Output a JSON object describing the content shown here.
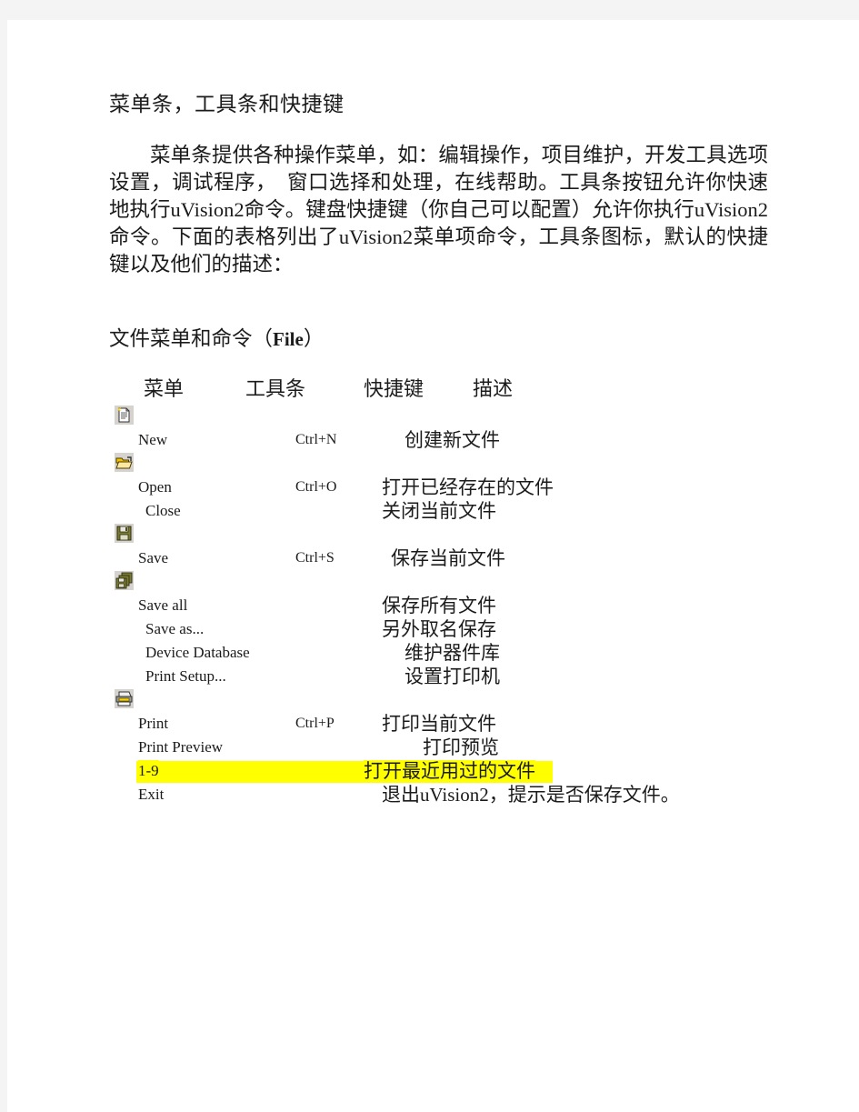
{
  "document": {
    "title": "菜单条，工具条和快捷键",
    "intro": "菜单条提供各种操作菜单，如：编辑操作，项目维护，开发工具选项设置，调试程序，　窗口选择和处理，在线帮助。工具条按钮允许你快速地执行uVision2命令。键盘快捷键（你自己可以配置）允许你执行uVision2命令。下面的表格列出了uVision2菜单项命令，工具条图标，默认的快捷键以及他们的描述：",
    "section_title_prefix": "文件菜单和命令（",
    "section_title_bold": "File",
    "section_title_suffix": "）"
  },
  "table": {
    "headers": {
      "menu": "菜单",
      "toolbar": "工具条",
      "shortcut": "快捷键",
      "description": "描述"
    },
    "rows": [
      {
        "icon": "new-file-icon",
        "menu": "New",
        "shortcut": "Ctrl+N",
        "description": "创建新文件",
        "highlight": false
      },
      {
        "icon": "open-folder-icon",
        "menu": "Open",
        "shortcut": "Ctrl+O",
        "description": "打开已经存在的文件",
        "highlight": false
      },
      {
        "icon": null,
        "menu": "Close",
        "shortcut": "",
        "description": "关闭当前文件",
        "highlight": false
      },
      {
        "icon": "save-disk-icon",
        "menu": "Save",
        "shortcut": "Ctrl+S",
        "description": "保存当前文件",
        "highlight": false
      },
      {
        "icon": "save-all-disks-icon",
        "menu": "Save all",
        "shortcut": "",
        "description": "保存所有文件",
        "highlight": false
      },
      {
        "icon": null,
        "menu": "Save as...",
        "shortcut": "",
        "description": "另外取名保存",
        "highlight": false
      },
      {
        "icon": null,
        "menu": "Device Database",
        "shortcut": "",
        "description": "维护器件库",
        "highlight": false
      },
      {
        "icon": null,
        "menu": "Print Setup...",
        "shortcut": "",
        "description": "设置打印机",
        "highlight": false
      },
      {
        "icon": "printer-icon",
        "menu": "Print",
        "shortcut": "Ctrl+P",
        "description": "打印当前文件",
        "highlight": false
      },
      {
        "icon": null,
        "menu": "Print Preview",
        "shortcut": "",
        "description": "打印预览",
        "highlight": false
      },
      {
        "icon": null,
        "menu": "1-9",
        "shortcut": "",
        "description": "打开最近用过的文件",
        "highlight": true
      },
      {
        "icon": null,
        "menu": "Exit",
        "shortcut": "",
        "description": "退出uVision2，提示是否保存文件。",
        "highlight": false
      }
    ]
  },
  "colors": {
    "page_background": "#ffffff",
    "canvas_background": "#f4f4f4",
    "text": "#1b1b1b",
    "highlight": "#ffff00",
    "icon_background": "#d6d3ce",
    "folder_yellow": "#ffe9a0",
    "disk_olive": "#7a7a34",
    "printer_gray": "#808080"
  }
}
